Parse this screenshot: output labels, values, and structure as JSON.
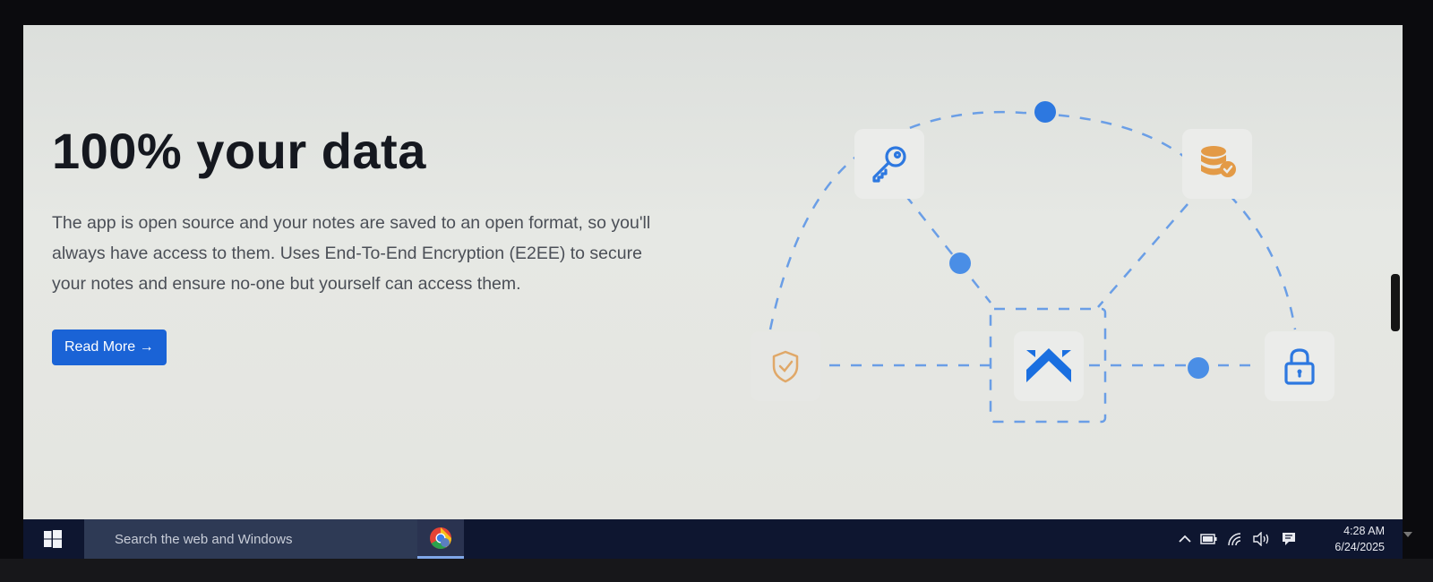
{
  "page": {
    "title": "100% your data",
    "description": "The app is open source and your notes are saved to an open format, so you'll always have access to them. Uses End-To-End Encryption (E2EE) to secure your notes and ensure no-one but yourself can access them.",
    "read_more_label": "Read More →"
  },
  "illustration": {
    "icons": [
      "key-icon",
      "database-check-icon",
      "shield-check-icon",
      "joplin-logo-icon",
      "lock-icon"
    ],
    "colors": {
      "blue": "#2d78e0",
      "orange": "#e39a46",
      "dot": "#4a8ee6",
      "line": "#6a9ee6"
    }
  },
  "taskbar": {
    "search_placeholder": "Search the web and Windows",
    "clock_time": "4:28 AM",
    "clock_date": "6/24/2025",
    "tray_icons": [
      "chevron-up-icon",
      "battery-icon",
      "wifi-icon",
      "speaker-icon",
      "notification-icon"
    ]
  }
}
